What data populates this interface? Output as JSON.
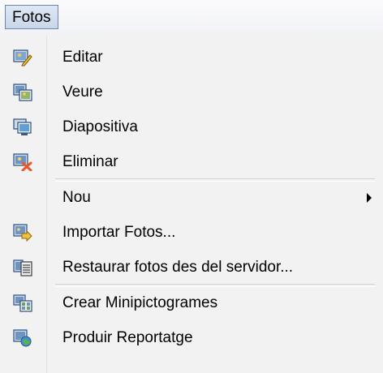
{
  "menubar": {
    "title": "Fotos"
  },
  "menu": {
    "items": [
      {
        "label": "Editar",
        "icon": "edit-photo-icon"
      },
      {
        "label": "Veure",
        "icon": "view-photo-icon"
      },
      {
        "label": "Diapositiva",
        "icon": "slideshow-icon"
      },
      {
        "label": "Eliminar",
        "icon": "delete-photo-icon"
      },
      {
        "label": "Nou",
        "icon": "submenu-arrow-icon"
      },
      {
        "label": "Importar Fotos...",
        "icon": "import-photos-icon"
      },
      {
        "label": "Restaurar fotos des del servidor...",
        "icon": "restore-photos-icon"
      },
      {
        "label": "Crear Minipictogrames",
        "icon": "create-thumbnails-icon"
      },
      {
        "label": "Produir Reportatge",
        "icon": "produce-report-icon"
      }
    ]
  },
  "colors": {
    "menu_background": "#f2f2f2",
    "title_highlight": "#c8d7ea",
    "title_border": "#6f86a6",
    "delete_cross": "#e8572a"
  }
}
